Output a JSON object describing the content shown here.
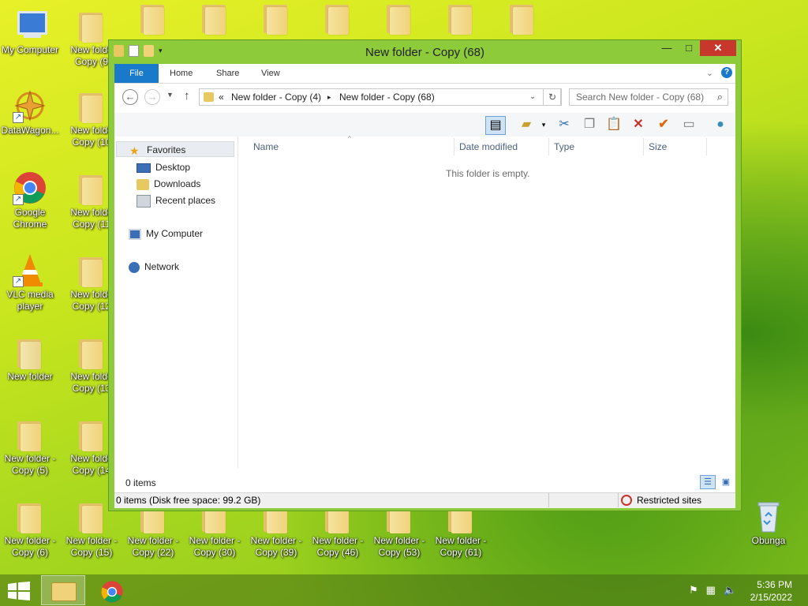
{
  "desktop": {
    "icons": [
      {
        "label": "My Computer"
      },
      {
        "label": "DataWagon..."
      },
      {
        "label": "Google Chrome"
      },
      {
        "label": "VLC media player"
      },
      {
        "label": "New folder"
      },
      {
        "label": "New folder - Copy (5)"
      },
      {
        "label": "New folder - Copy (6)"
      },
      {
        "label": "New folde Copy (9"
      },
      {
        "label": "New folde Copy (10"
      },
      {
        "label": "New folde Copy (11"
      },
      {
        "label": "New folde Copy (12"
      },
      {
        "label": "New folde Copy (13"
      },
      {
        "label": "New folde Copy (14"
      },
      {
        "label": "New folder - Copy (15)"
      },
      {
        "label": "New folder - Copy (22)"
      },
      {
        "label": "New folder - Copy (30)"
      },
      {
        "label": "New folder - Copy (39)"
      },
      {
        "label": "New folder - Copy (46)"
      },
      {
        "label": "New folder - Copy (53)"
      },
      {
        "label": "New folder - Copy (61)"
      },
      {
        "label": "Obunga"
      }
    ]
  },
  "window": {
    "title": "New folder - Copy (68)",
    "minimize": "—",
    "maximize": "□",
    "close": "✕"
  },
  "ribbon": {
    "tabs": [
      "File",
      "Home",
      "Share",
      "View"
    ],
    "help": "?"
  },
  "address": {
    "prefix": "«",
    "crumbs": [
      "New folder - Copy (4)",
      "New folder - Copy (68)"
    ],
    "search_placeholder": "Search New folder - Copy (68)"
  },
  "nav": {
    "favorites": "Favorites",
    "items": [
      "Desktop",
      "Downloads",
      "Recent places"
    ],
    "computer": "My Computer",
    "network": "Network"
  },
  "columns": [
    "Name",
    "Date modified",
    "Type",
    "Size"
  ],
  "content": {
    "empty_text": "This folder is empty."
  },
  "footer": {
    "items": "0 items"
  },
  "status": {
    "left": "0 items (Disk free space: 99.2 GB)",
    "zone": "Restricted sites"
  },
  "taskbar": {
    "time": "5:36 PM",
    "date": "2/15/2022"
  },
  "colors": {
    "accent": "#1979ca",
    "window_frame": "#8dcb3a",
    "close": "#c7372b"
  }
}
